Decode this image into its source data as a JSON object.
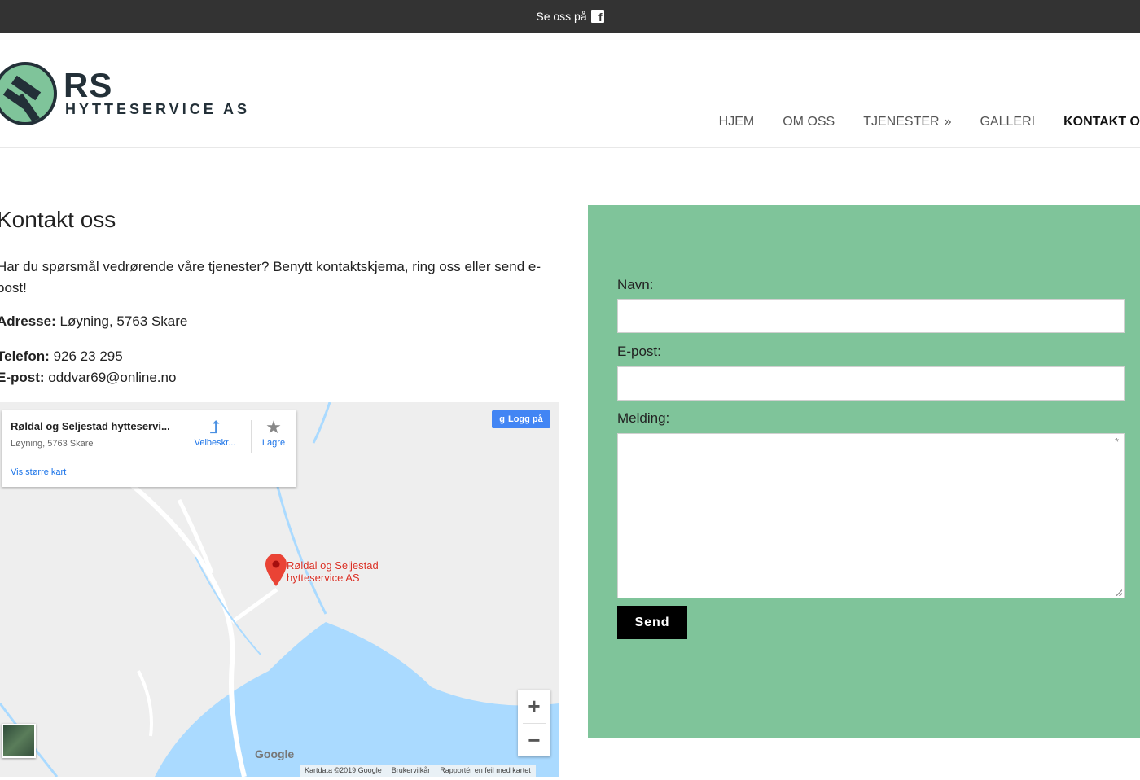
{
  "topbar": {
    "text": "Se oss på",
    "icon": "facebook-icon"
  },
  "logo": {
    "main": "RS",
    "sub": "HYTTESERVICE AS",
    "badge_color": "#7fc49a",
    "dark_color": "#233038"
  },
  "nav": {
    "items": [
      {
        "label": "HJEM"
      },
      {
        "label": "OM OSS"
      },
      {
        "label": "TJENESTER",
        "arrow": "»"
      },
      {
        "label": "GALLERI"
      },
      {
        "label": "KONTAKT O"
      }
    ]
  },
  "page": {
    "title": "Kontakt oss",
    "intro": "Har du spørsmål vedrørende våre tjenester? Benytt kontaktskjema, ring oss eller send e-post!",
    "address_label": "Adresse:",
    "address_value": "Løyning, 5763 Skare",
    "phone_label": "Telefon:",
    "phone_value": "926 23 295",
    "email_label": "E-post:",
    "email_value": "oddvar69@online.no"
  },
  "map": {
    "place_name": "Røldal og Seljestad hytteservi...",
    "place_address": "Løyning, 5763 Skare",
    "directions_label": "Veibeskr...",
    "save_label": "Lagre",
    "larger_map_label": "Vis større kart",
    "login_label": "Logg på",
    "pin_label_line1": "Røldal og Seljestad",
    "pin_label_line2": "hytteservice AS",
    "zoom_in": "+",
    "zoom_out": "−",
    "google_logo": "Google",
    "footer": [
      "Kartdata ©2019 Google",
      "Brukervilkår",
      "Rapportér en feil med kartet"
    ]
  },
  "form": {
    "panel_color": "#7fc49a",
    "name_label": "Navn:",
    "email_label": "E-post:",
    "message_label": "Melding:",
    "required_mark": "*",
    "send_label": "Send"
  }
}
